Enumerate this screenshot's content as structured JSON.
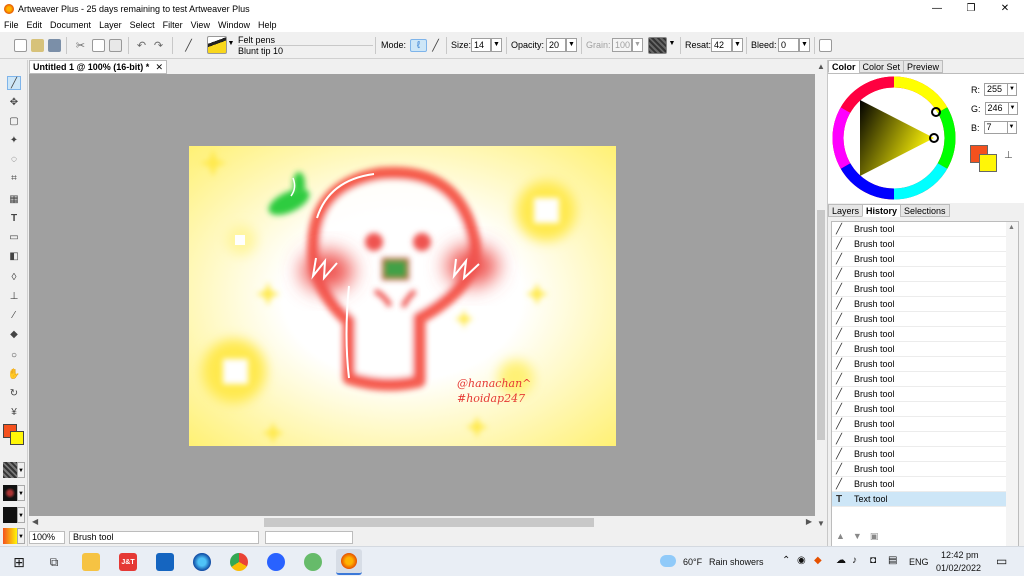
{
  "window": {
    "title": "Artweaver Plus - 25 days remaining to test Artweaver Plus",
    "minimize": "—",
    "maximize": "❐",
    "close": "✕"
  },
  "menu": [
    "File",
    "Edit",
    "Document",
    "Layer",
    "Select",
    "Filter",
    "View",
    "Window",
    "Help"
  ],
  "options": {
    "brush_category": "Felt pens",
    "brush_variant": "Blunt tip 10",
    "mode_label": "Mode:",
    "size_label": "Size:",
    "size_value": "14",
    "opacity_label": "Opacity:",
    "opacity_value": "20",
    "grain_label": "Grain:",
    "grain_value": "100",
    "resat_label": "Resat:",
    "resat_value": "42",
    "bleed_label": "Bleed:",
    "bleed_value": "0"
  },
  "document": {
    "tab_title": "Untitled 1 @ 100% (16-bit) *",
    "close": "✕",
    "signature_line1": "@hanachan^",
    "signature_line2": "#hoidap247"
  },
  "status": {
    "zoom": "100%",
    "tool": "Brush tool"
  },
  "color_panel": {
    "tabs": [
      "Color",
      "Color Set",
      "Preview"
    ],
    "r_label": "R:",
    "g_label": "G:",
    "b_label": "B:",
    "r": "255",
    "g": "246",
    "b": "7",
    "foreground": "#f4511e",
    "background": "#fff607"
  },
  "history_panel": {
    "tabs": [
      "Layers",
      "History",
      "Selections"
    ],
    "items": [
      "Brush tool",
      "Brush tool",
      "Brush tool",
      "Brush tool",
      "Brush tool",
      "Brush tool",
      "Brush tool",
      "Brush tool",
      "Brush tool",
      "Brush tool",
      "Brush tool",
      "Brush tool",
      "Brush tool",
      "Brush tool",
      "Brush tool",
      "Brush tool",
      "Brush tool",
      "Brush tool",
      "Text tool"
    ]
  },
  "taskbar": {
    "weather_temp": "60°F",
    "weather_desc": "Rain showers",
    "language": "ENG",
    "time": "12:42 pm",
    "date": "01/02/2022"
  }
}
